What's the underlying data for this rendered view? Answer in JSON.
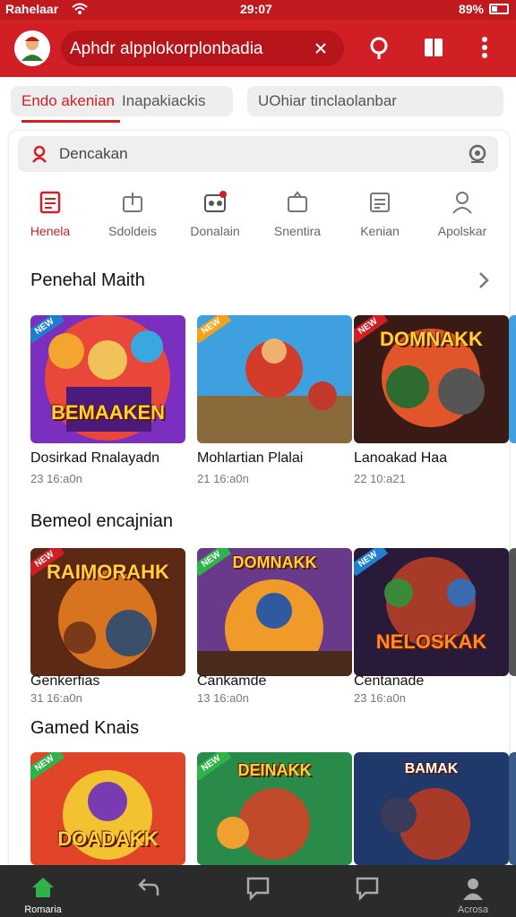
{
  "status": {
    "left": "Rahelaar",
    "time": "29:07",
    "battery": "89%"
  },
  "header": {
    "search_text": "Aphdr alpplokorplonbadia"
  },
  "filters": [
    "Endo akenian",
    "Inapakiackis",
    "UOhiar tinclaolanbar"
  ],
  "search": {
    "placeholder": "Dencakan"
  },
  "categories": [
    "Henela",
    "Sdoldeis",
    "Donalain",
    "Snentira",
    "Kenian",
    "Apolskar"
  ],
  "sections": [
    {
      "title": "Penehal Maith",
      "items": [
        {
          "title": "Dosirkad Rnalayadn",
          "meta": "23 16:a0n",
          "logo": "BEMAAKEN",
          "tag": "NEW"
        },
        {
          "title": "Mohlartian Plalai",
          "meta": "21 16:a0n",
          "logo": "",
          "tag": "NEW"
        },
        {
          "title": "Lanoakad Haa",
          "meta": "22 10:a21",
          "logo": "DOMNAKK",
          "tag": "NEW"
        }
      ]
    },
    {
      "title": "Bemeol encajnian",
      "items": [
        {
          "title": "Genkerfias",
          "meta": "31 16:a0n",
          "logo": "RAIMORAHK",
          "tag": "NEW"
        },
        {
          "title": "Cankamde",
          "meta": "13 16:a0n",
          "logo": "DOMNAKK",
          "tag": "NEW"
        },
        {
          "title": "Centanade",
          "meta": "23 16:a0n",
          "logo": "NELOSKAK",
          "tag": "NEW"
        }
      ]
    },
    {
      "title": "Gamed Knais",
      "items": [
        {
          "title": "",
          "meta": "",
          "logo": "DOADAKK",
          "tag": "NEW"
        },
        {
          "title": "",
          "meta": "",
          "logo": "DEINAKK",
          "tag": "NEW"
        },
        {
          "title": "",
          "meta": "",
          "logo": "BAMAK",
          "tag": ""
        }
      ]
    }
  ],
  "bottom_nav": [
    "Romaria",
    "",
    "",
    "",
    "Acrosa"
  ],
  "bottom_nav_promo": "",
  "colors": {
    "brand": "#d11f26",
    "nav_bg": "#2b2b2b",
    "active": "#2fb24a"
  }
}
